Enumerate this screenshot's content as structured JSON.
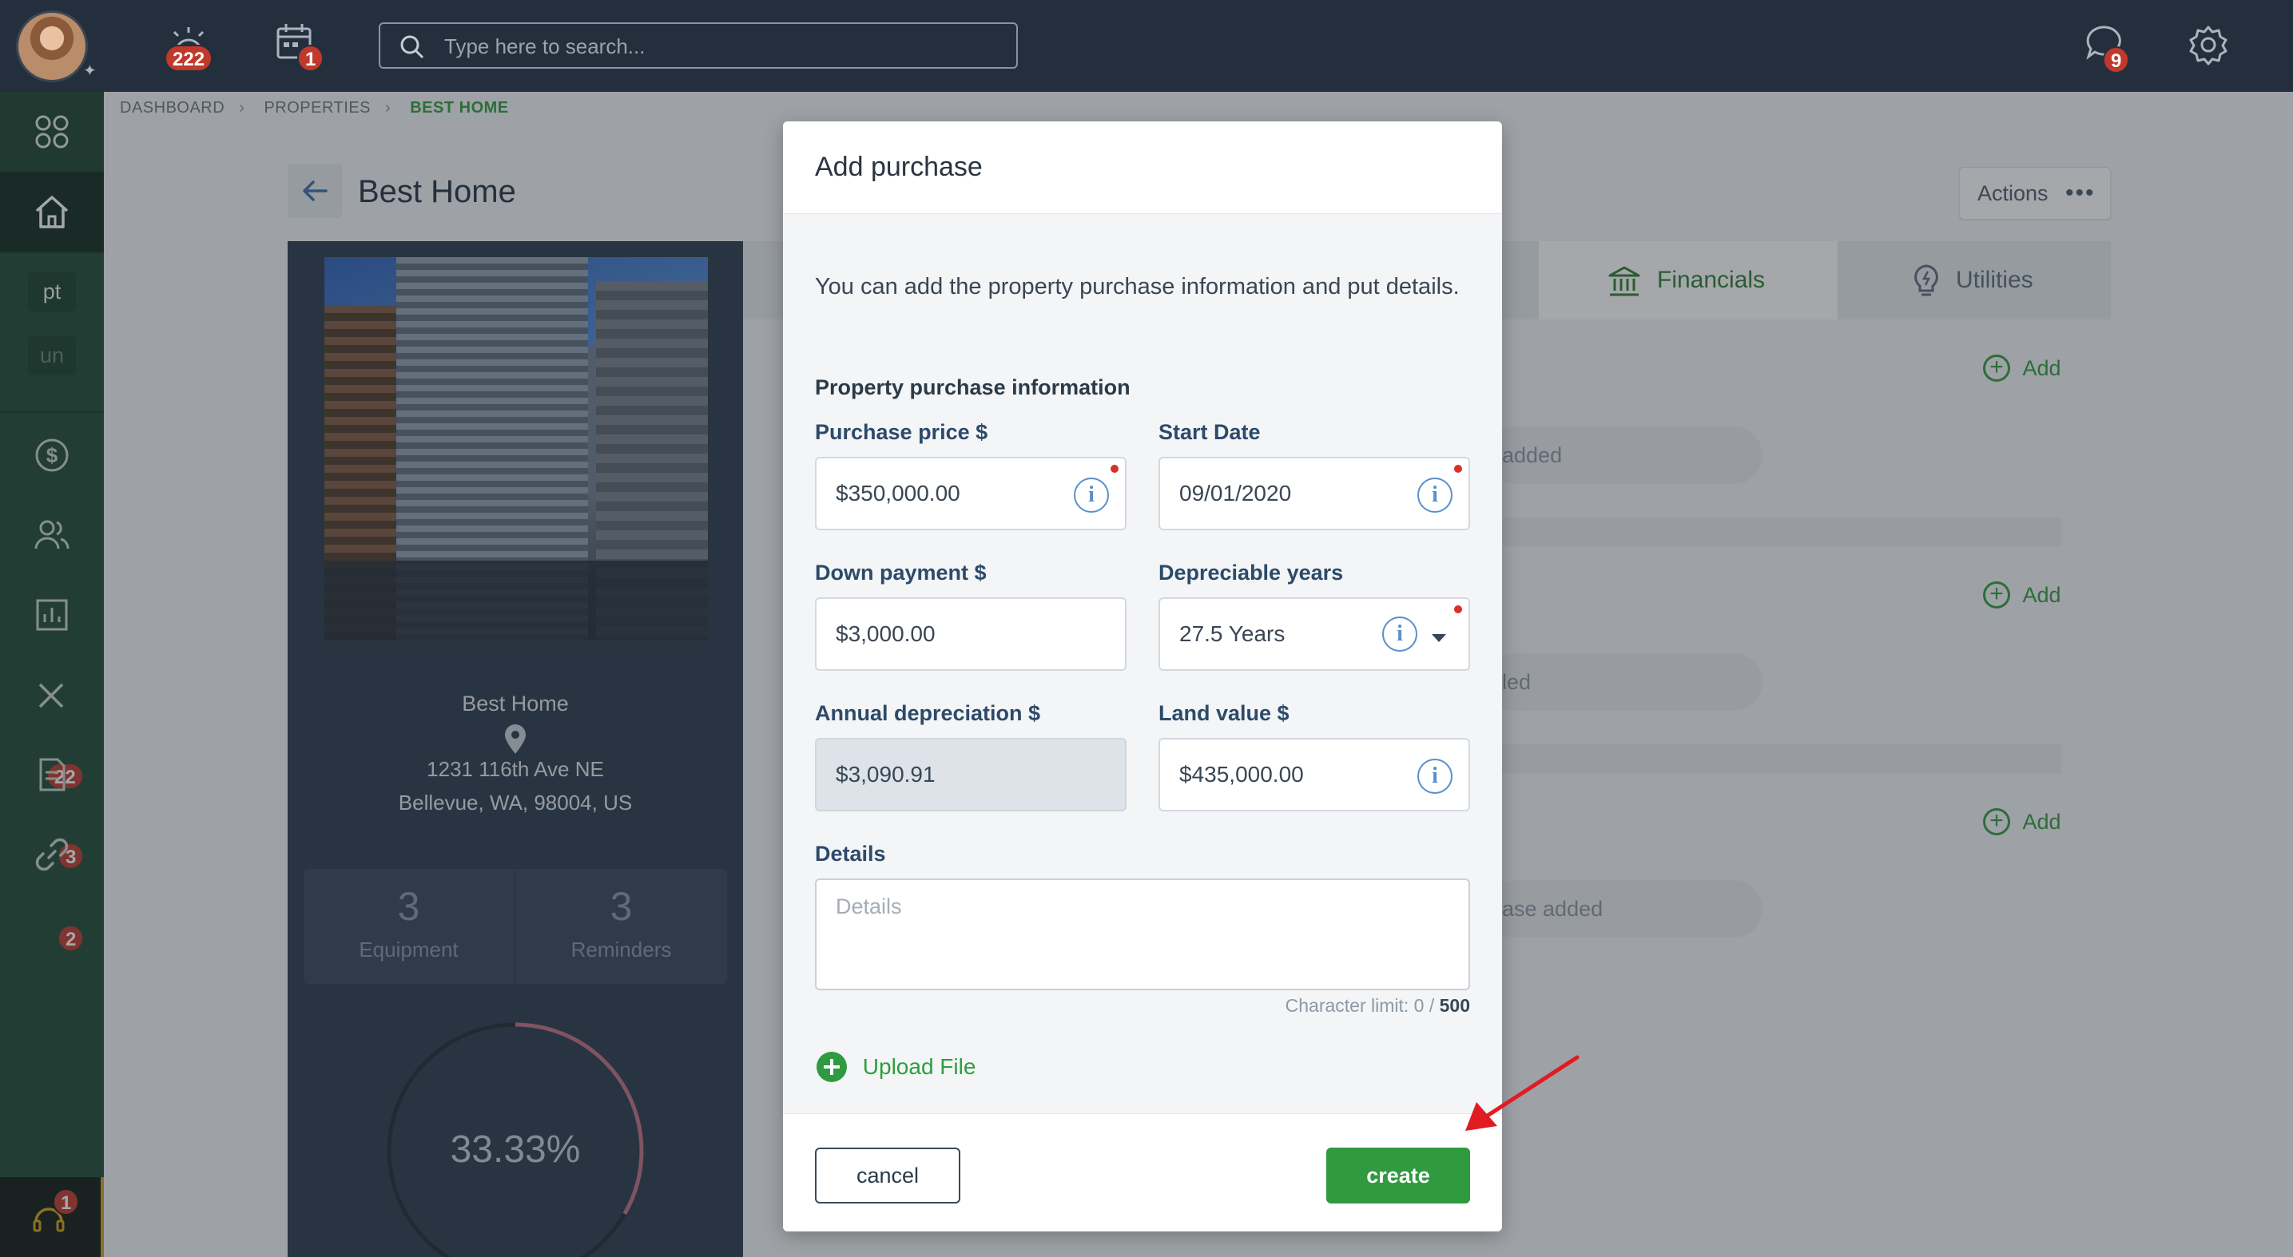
{
  "topbar": {
    "alerts_badge": "222",
    "calendar_badge": "1",
    "search_placeholder": "Type here to search...",
    "messages_badge": "9"
  },
  "sidebar": {
    "chip_pt": "pt",
    "chip_un": "un",
    "maintenance_badge": "22",
    "documents_badge": "3",
    "links_badge": "2",
    "help_badge": "1"
  },
  "breadcrumb": [
    "DASHBOARD",
    "PROPERTIES",
    "BEST HOME"
  ],
  "page": {
    "title": "Best Home",
    "actions_label": "Actions"
  },
  "property": {
    "name": "Best Home",
    "address_line1": "1231 116th Ave NE",
    "address_line2": "Bellevue, WA, 98004, US",
    "equipment_count": "3",
    "equipment_label": "Equipment",
    "reminders_count": "3",
    "reminders_label": "Reminders",
    "progress_text": "33.33%",
    "progress_value": 0.3333
  },
  "tabs": {
    "financials": "Financials",
    "utilities": "Utilities"
  },
  "sections": {
    "add_label": "Add",
    "row1_text": "added",
    "row2_text": "led",
    "row3_text": "ase added"
  },
  "modal": {
    "title": "Add purchase",
    "description": "You can add the property purchase information and put details.",
    "section_title": "Property purchase information",
    "purchase_price_label": "Purchase price $",
    "purchase_price_value": "$350,000.00",
    "start_date_label": "Start Date",
    "start_date_value": "09/01/2020",
    "down_payment_label": "Down payment $",
    "down_payment_value": "$3,000.00",
    "depreciable_years_label": "Depreciable years",
    "depreciable_years_value": "27.5 Years",
    "annual_depreciation_label": "Annual depreciation $",
    "annual_depreciation_value": "$3,090.91",
    "land_value_label": "Land value $",
    "land_value_value": "$435,000.00",
    "details_label": "Details",
    "details_placeholder": "Details",
    "char_limit_prefix": "Character limit: 0 / ",
    "char_limit_max": "500",
    "upload_label": "Upload File",
    "cancel_label": "cancel",
    "create_label": "create"
  },
  "colors": {
    "topbar": "#242f3e",
    "sidebar": "#1e4a34",
    "accent_green": "#2f9a3f",
    "badge_red": "#c0392b",
    "annotation_arrow": "#e11b22"
  }
}
